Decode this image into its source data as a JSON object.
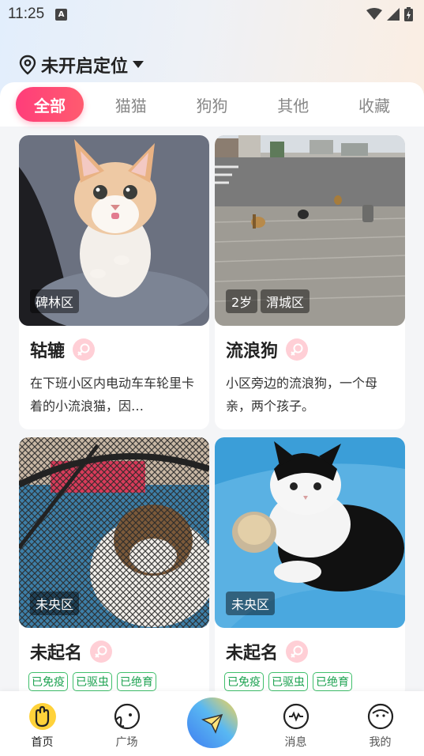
{
  "status": {
    "time": "11:25",
    "indicator": "A"
  },
  "location": {
    "label": "未开启定位"
  },
  "tabs": [
    {
      "label": "全部",
      "active": true
    },
    {
      "label": "猫猫",
      "active": false
    },
    {
      "label": "狗狗",
      "active": false
    },
    {
      "label": "其他",
      "active": false
    },
    {
      "label": "收藏",
      "active": false
    }
  ],
  "cards": [
    {
      "name": "轱辘",
      "tag": "碑林区",
      "desc": "在下班小区内电动车车轮里卡着的小流浪猫，因…",
      "gender": "female"
    },
    {
      "name": "流浪狗",
      "tag_age": "2岁",
      "tag": "渭城区",
      "desc": "小区旁边的流浪狗，一个母亲，两个孩子。",
      "gender": "female"
    },
    {
      "name": "未起名",
      "tag": "未央区",
      "badges": [
        "已免疫",
        "已驱虫",
        "已绝育"
      ],
      "gender": "female"
    },
    {
      "name": "未起名",
      "tag": "未央区",
      "badges": [
        "已免疫",
        "已驱虫",
        "已绝育"
      ],
      "gender": "female"
    }
  ],
  "nav": [
    {
      "label": "首页",
      "icon": "home-hand-icon",
      "active": true
    },
    {
      "label": "广场",
      "icon": "plaza-icon",
      "active": false
    },
    {
      "label": "",
      "icon": "send-post-icon",
      "active": false
    },
    {
      "label": "消息",
      "icon": "message-icon",
      "active": false
    },
    {
      "label": "我的",
      "icon": "profile-icon",
      "active": false
    }
  ],
  "colors": {
    "accent": "#ff4a74",
    "badge_green": "#1ba14f",
    "gender_pink": "#ffcfd6"
  }
}
